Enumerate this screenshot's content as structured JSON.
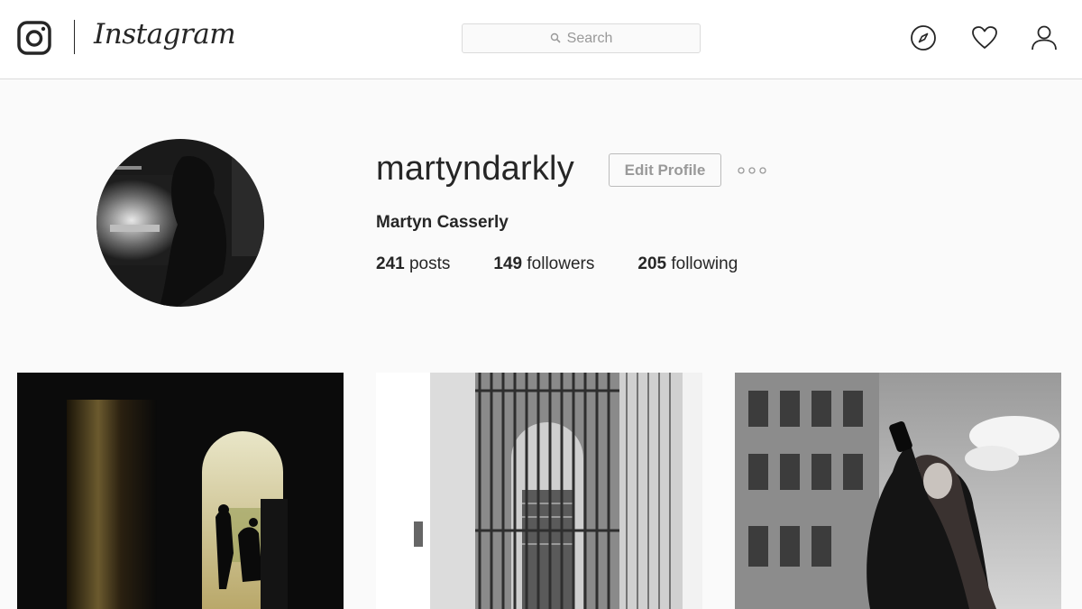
{
  "header": {
    "logo_icon": "instagram-camera-icon",
    "wordmark": "Instagram",
    "search": {
      "placeholder": "Search",
      "icon": "search-icon"
    },
    "nav_icons": [
      "compass-icon",
      "heart-icon",
      "person-icon"
    ]
  },
  "profile": {
    "username": "martyndarkly",
    "edit_label": "Edit Profile",
    "more_icon": "more-options-icon",
    "full_name": "Martyn Casserly",
    "stats": [
      {
        "count": "241",
        "label": "posts"
      },
      {
        "count": "149",
        "label": "followers"
      },
      {
        "count": "205",
        "label": "following"
      }
    ]
  },
  "posts": [
    {
      "kind": "photo",
      "tone": "dark-archway-silhouettes"
    },
    {
      "kind": "photo",
      "tone": "gated-alley-stairs"
    },
    {
      "kind": "photo",
      "tone": "woman-with-camera-building"
    }
  ],
  "colors": {
    "text": "#262626",
    "muted": "#999999",
    "border": "#dbdbdb",
    "background": "#fafafa"
  }
}
